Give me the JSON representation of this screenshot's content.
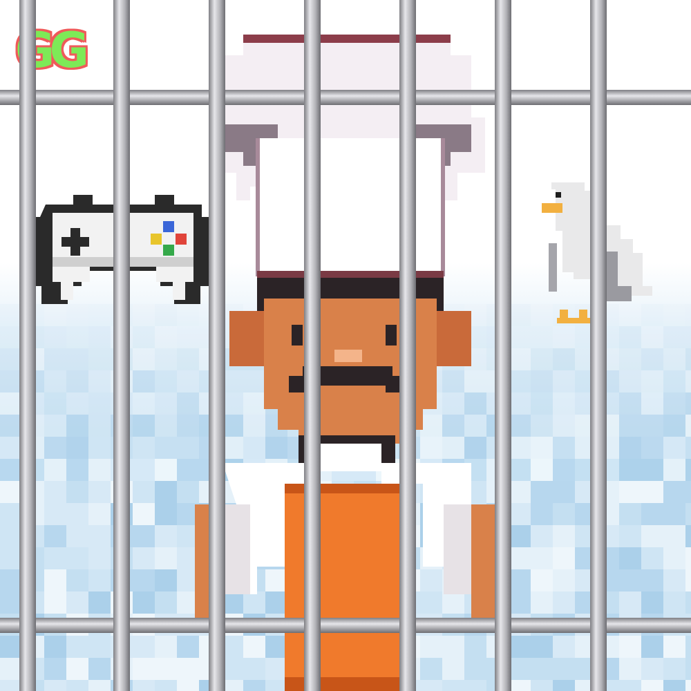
{
  "logo": {
    "text": "GG",
    "fill_color": "#7dea57",
    "outline_color": "#ef5a5a"
  },
  "scene": {
    "subject": "chef",
    "background_colors": {
      "top": "#ffffff",
      "bottom": "#bcdaee"
    },
    "chef_colors": {
      "skin": "#d9814a",
      "apron": "#f07a2c",
      "hat": "#f4eef3",
      "hat_shadow": "#8a7a86",
      "hair": "#2b2326",
      "shirt": "#ffffff"
    },
    "bar_color": "#a9a9ad",
    "icons": [
      "gamepad-icon",
      "seagull-icon"
    ]
  }
}
